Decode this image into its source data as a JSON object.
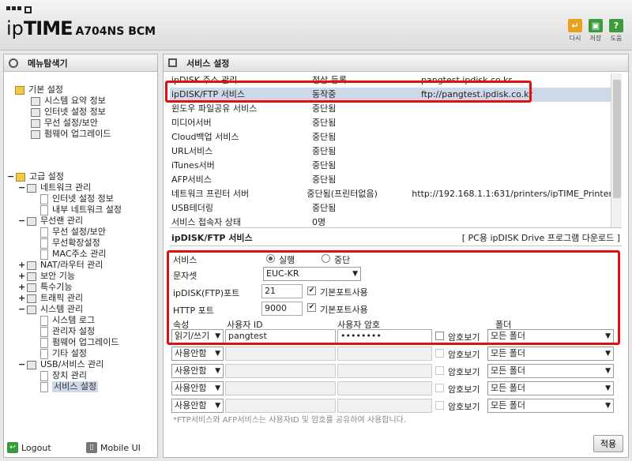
{
  "header": {
    "brand_ip": "ip",
    "brand_time": "TIME",
    "model": "A704NS BCM",
    "tools": [
      {
        "label": "다시",
        "icon": "undo-icon",
        "color": "#e6a21a"
      },
      {
        "label": "저장",
        "icon": "save-icon",
        "color": "#3b9a3b"
      },
      {
        "label": "도움",
        "icon": "help-icon",
        "color": "#3b9a3b"
      }
    ]
  },
  "left": {
    "title": "메뉴탐색기",
    "basic_root": "기본 설정",
    "basic_items": [
      "시스템 요약 정보",
      "인터넷 설정 정보",
      "무선 설정/보안",
      "펌웨어 업그레이드"
    ],
    "advanced_root": "고급 설정",
    "network": "네트워크 관리",
    "network_items": [
      "인터넷 설정 정보",
      "내부 네트워크 설정"
    ],
    "wireless": "무선랜 관리",
    "wireless_items": [
      "무선 설정/보안",
      "무선확장설정",
      "MAC주소 관리"
    ],
    "nat": "NAT/라우터 관리",
    "security": "보안 기능",
    "special": "특수기능",
    "traffic": "트래픽 관리",
    "system": "시스템 관리",
    "system_items": [
      "시스템 로그",
      "관리자 설정",
      "펌웨어 업그레이드",
      "기타 설정"
    ],
    "usb": "USB/서비스 관리",
    "usb_items": [
      "장치 관리",
      "서비스 설정"
    ],
    "logout": "Logout",
    "mobile": "Mobile UI"
  },
  "right": {
    "title": "서비스 설정",
    "services": [
      [
        "ipDISK 주소 관리",
        "정상 등록",
        "pangtest.ipdisk.co.kr"
      ],
      [
        "ipDISK/FTP 서비스",
        "동작중",
        "ftp://pangtest.ipdisk.co.kr"
      ],
      [
        "윈도우 파일공유 서비스",
        "중단됨",
        ""
      ],
      [
        "미디어서버",
        "중단됨",
        ""
      ],
      [
        "Cloud백업 서비스",
        "중단됨",
        ""
      ],
      [
        "URL서비스",
        "중단됨",
        ""
      ],
      [
        "iTunes서버",
        "중단됨",
        ""
      ],
      [
        "AFP서비스",
        "중단됨",
        ""
      ],
      [
        "네트워크 프린터 서버",
        "중단됨(프린터없음)",
        "http://192.168.1.1:631/printers/ipTIME_Printer"
      ],
      [
        "USB테더링",
        "중단됨",
        ""
      ],
      [
        "서비스 접속자 상태",
        "0명",
        ""
      ]
    ],
    "section_title": "ipDISK/FTP 서비스",
    "section_link": "[ PC용 ipDISK Drive 프로그램 다운로드 ]",
    "service_label": "서비스",
    "run_label": "실행",
    "stop_label": "중단",
    "charset_label": "문자셋",
    "charset_value": "EUC-KR",
    "ftp_port_label": "ipDISK(FTP)포트",
    "ftp_port_value": "21",
    "http_port_label": "HTTP 포트",
    "http_port_value": "9000",
    "default_port_label": "기본포트사용",
    "col_attr": "속성",
    "col_user": "사용자 ID",
    "col_pass": "사용자 암호",
    "col_folder": "폴더",
    "users": [
      {
        "attr": "읽기/쓰기",
        "id": "pangtest",
        "pass": "••••••••",
        "show": "암호보기",
        "folder": "모든 폴더"
      },
      {
        "attr": "사용안함",
        "id": "",
        "pass": "",
        "show": "암호보기",
        "folder": "모든 폴더"
      },
      {
        "attr": "사용안함",
        "id": "",
        "pass": "",
        "show": "암호보기",
        "folder": "모든 폴더"
      },
      {
        "attr": "사용안함",
        "id": "",
        "pass": "",
        "show": "암호보기",
        "folder": "모든 폴더"
      },
      {
        "attr": "사용안함",
        "id": "",
        "pass": "",
        "show": "암호보기",
        "folder": "모든 폴더"
      }
    ],
    "note": "*FTP서비스와 AFP서비스는 사용자ID 및 암호를 공유하여 사용합니다.",
    "apply": "적용"
  }
}
